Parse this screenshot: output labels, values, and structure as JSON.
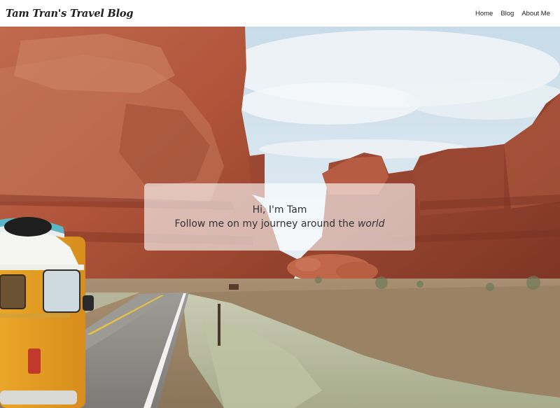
{
  "header": {
    "title": "Tam Tran's Travel Blog",
    "nav": [
      {
        "label": "Home"
      },
      {
        "label": "Blog"
      },
      {
        "label": "About Me"
      }
    ]
  },
  "hero": {
    "greeting": "Hi, I'm Tam",
    "tagline_prefix": "Follow me on my journey around the ",
    "tagline_emphasis": "world",
    "image_description_icon": "desert-road-photo"
  },
  "colors": {
    "nav_bg": "#ffffff",
    "text": "#333333",
    "rock": "#b5523a",
    "sky": "#cfe2ee",
    "van": "#e7a42b"
  }
}
